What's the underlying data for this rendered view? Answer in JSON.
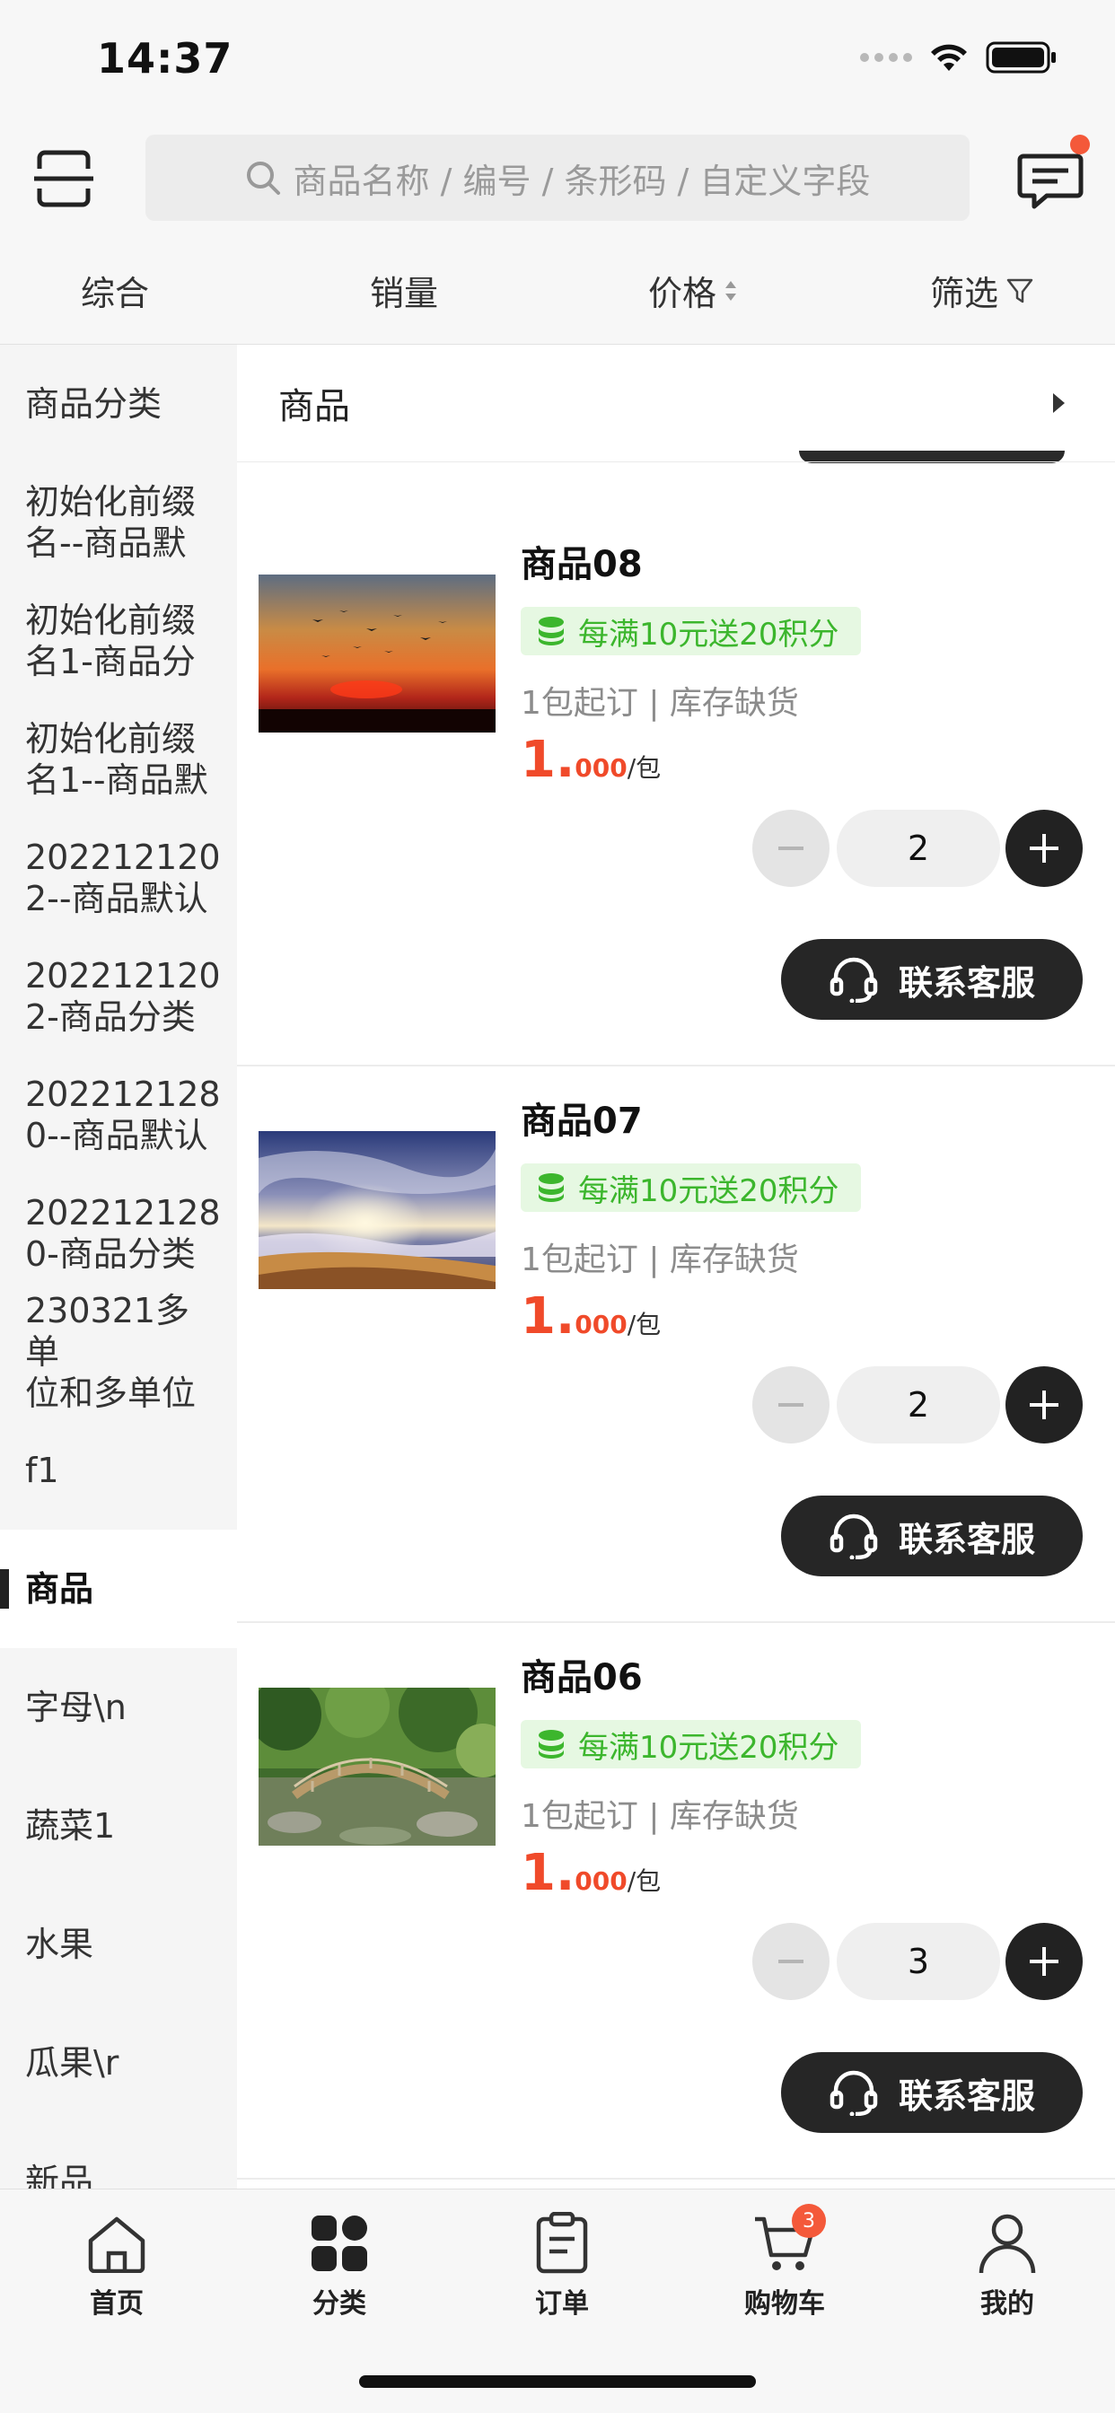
{
  "status_bar": {
    "time": "14:37"
  },
  "search": {
    "placeholder": "商品名称 / 编号 / 条形码 / 自定义字段"
  },
  "sort_bar": {
    "items": [
      "综合",
      "销量",
      "价格",
      "筛选"
    ]
  },
  "sidebar": {
    "items": [
      {
        "line1": "商品分类",
        "line2": ""
      },
      {
        "line1": "初始化前缀",
        "line2": "名--商品默"
      },
      {
        "line1": "初始化前缀",
        "line2": "名1-商品分"
      },
      {
        "line1": "初始化前缀",
        "line2": "名1--商品默"
      },
      {
        "line1": "202212120",
        "line2": "2--商品默认"
      },
      {
        "line1": "202212120",
        "line2": "2-商品分类"
      },
      {
        "line1": "202212128",
        "line2": "0--商品默认"
      },
      {
        "line1": "202212128",
        "line2": "0-商品分类"
      },
      {
        "line1": "230321多单",
        "line2": "位和多单位"
      },
      {
        "line1": "f1",
        "line2": ""
      },
      {
        "line1": "商品",
        "line2": ""
      },
      {
        "line1": "字母\\n",
        "line2": ""
      },
      {
        "line1": "蔬菜1",
        "line2": ""
      },
      {
        "line1": "水果",
        "line2": ""
      },
      {
        "line1": "瓜果\\r",
        "line2": ""
      },
      {
        "line1": "新品",
        "line2": ""
      }
    ],
    "active_index": 10
  },
  "section": {
    "title": "商品"
  },
  "products": [
    {
      "name": "商品08",
      "promo": "每满10元送20积分",
      "stock": "1包起订 | 库存缺货",
      "price_int": "1.",
      "price_dec": "000",
      "price_unit": "/包",
      "qty": "2",
      "contact": "联系客服",
      "image": "sunset-birds"
    },
    {
      "name": "商品07",
      "promo": "每满10元送20积分",
      "stock": "1包起订 | 库存缺货",
      "price_int": "1.",
      "price_dec": "000",
      "price_unit": "/包",
      "qty": "2",
      "contact": "联系客服",
      "image": "beach-sunrise"
    },
    {
      "name": "商品06",
      "promo": "每满10元送20积分",
      "stock": "1包起订 | 库存缺货",
      "price_int": "1.",
      "price_dec": "000",
      "price_unit": "/包",
      "qty": "3",
      "contact": "联系客服",
      "image": "garden-bridge"
    }
  ],
  "tabbar": {
    "items": [
      {
        "label": "首页",
        "icon": "home-icon"
      },
      {
        "label": "分类",
        "icon": "category-icon"
      },
      {
        "label": "订单",
        "icon": "order-icon"
      },
      {
        "label": "购物车",
        "icon": "cart-icon",
        "badge": "3"
      },
      {
        "label": "我的",
        "icon": "user-icon"
      }
    ]
  },
  "colors": {
    "accent_red": "#f04a2a",
    "promo_green": "#3cb62d",
    "dark_button": "#262626"
  }
}
